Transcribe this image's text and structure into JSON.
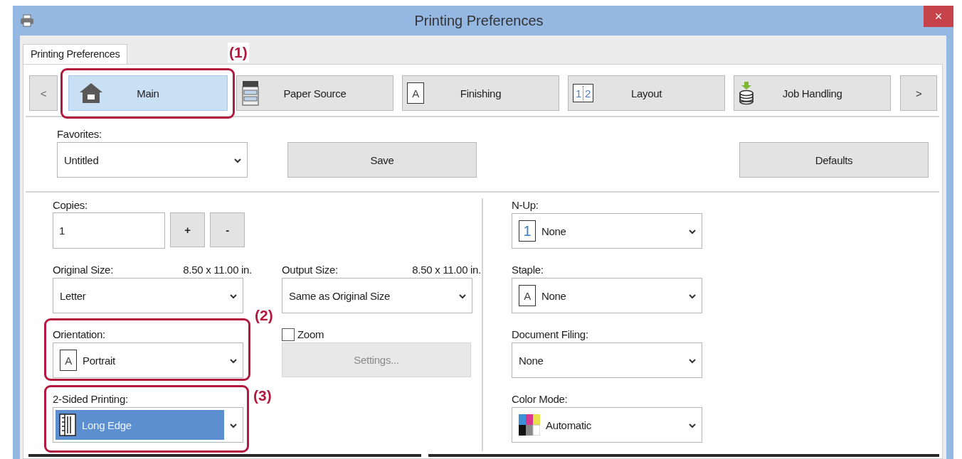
{
  "window": {
    "title": "Printing Preferences",
    "close": "×"
  },
  "tabs": [
    {
      "label": "Printing Preferences",
      "selected": true
    }
  ],
  "nav": {
    "prev": "<",
    "next": ">",
    "items": [
      {
        "label": "Main",
        "kind": "home",
        "selected": true
      },
      {
        "label": "Paper Source",
        "kind": "copier",
        "selected": false
      },
      {
        "label": "Finishing",
        "kind": "page",
        "glyph": "A",
        "selected": false
      },
      {
        "label": "Layout",
        "kind": "layout",
        "glyphs": [
          "1",
          "2"
        ],
        "selected": false
      },
      {
        "label": "Job Handling",
        "kind": "storage",
        "selected": false
      }
    ]
  },
  "favorites": {
    "label": "Favorites:",
    "value": "Untitled"
  },
  "save": "Save",
  "defaults": "Defaults",
  "copies": {
    "label": "Copies:",
    "value": "1",
    "plus": "+",
    "minus": "-"
  },
  "original_size": {
    "label": "Original Size:",
    "reading": "8.50 x 11.00 in.",
    "value": "Letter"
  },
  "output_size": {
    "label": "Output Size:",
    "reading": "8.50 x 11.00 in.",
    "value": "Same as Original Size"
  },
  "orientation": {
    "label": "Orientation:",
    "value": "Portrait",
    "glyph": "A"
  },
  "zoom": {
    "label": "Zoom",
    "checked": false
  },
  "settings": {
    "label": "Settings...",
    "disabled": true
  },
  "two_sided": {
    "label": "2-Sided Printing:",
    "value": "Long Edge",
    "highlighted": true
  },
  "n_up": {
    "label": "N-Up:",
    "value": "None",
    "glyph": "1"
  },
  "staple": {
    "label": "Staple:",
    "value": "None",
    "glyph": "A"
  },
  "document_filing": {
    "label": "Document Filing:",
    "value": "None"
  },
  "color_mode": {
    "label": "Color Mode:",
    "value": "Automatic"
  },
  "callouts": [
    {
      "label": "(1)"
    },
    {
      "label": "(2)"
    },
    {
      "label": "(3)"
    }
  ]
}
